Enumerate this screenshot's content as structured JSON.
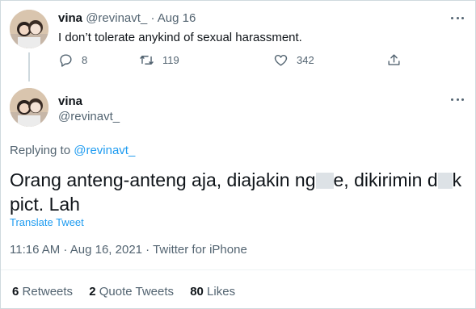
{
  "parent_tweet": {
    "name": "vina",
    "handle": "@revinavt_",
    "dot": "·",
    "date": "Aug 16",
    "text": "I don’t tolerate anykind of sexual harassment.",
    "replies": "8",
    "retweets": "119",
    "likes": "342"
  },
  "main_tweet": {
    "name": "vina",
    "handle": "@revinavt_",
    "replying_prefix": "Replying to",
    "replying_handle": "@revinavt_",
    "text_part1": "Orang anteng-anteng aja, diajakin ng",
    "text_part2": "e, dikirimin d",
    "text_part3": "k pict. Lah",
    "translate": "Translate Tweet",
    "timestamp": "11:16 AM · Aug 16, 2021 · Twitter for iPhone",
    "stats": {
      "retweets_count": "6",
      "retweets_label": "Retweets",
      "quotes_count": "2",
      "quotes_label": "Quote Tweets",
      "likes_count": "80",
      "likes_label": "Likes"
    }
  },
  "colors": {
    "link": "#1d9bf0",
    "muted": "#536471",
    "text": "#0f1419"
  },
  "icons": [
    "avatar",
    "more-icon",
    "reply-icon",
    "retweet-icon",
    "like-icon",
    "share-icon"
  ]
}
